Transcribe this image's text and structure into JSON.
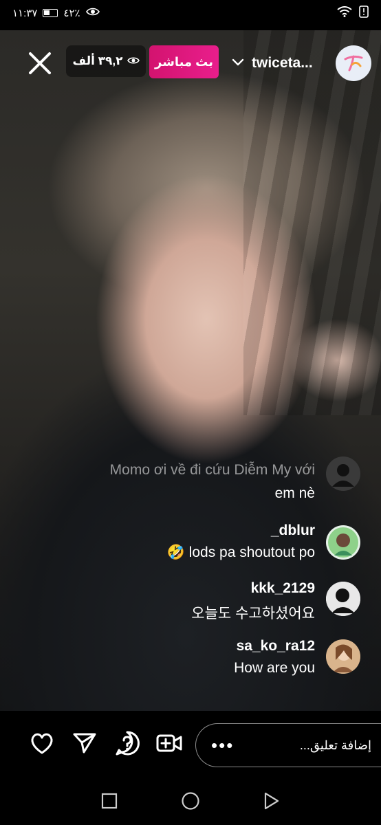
{
  "status_bar": {
    "time": "١١:٣٧",
    "battery": "٤٢٪",
    "icons": [
      "battery-icon",
      "eye-comfort-icon",
      "wifi-icon",
      "alert-icon"
    ]
  },
  "header": {
    "viewer_count": "٣٩,٢ ألف",
    "live_label": "بث مباشر",
    "username": "twiceta...",
    "colors": {
      "live": "#e91e8c"
    }
  },
  "comments": [
    {
      "user": "",
      "text_lines": [
        "Momo ơi về đi cứu Diễm My với",
        "em nè"
      ],
      "avatar": "default-avatar-icon"
    },
    {
      "user": "_dblur",
      "text": "🤣 lods pa shoutout po",
      "avatar": "user-avatar"
    },
    {
      "user": "kkk_2129",
      "text": "오늘도 수고하셨어요",
      "avatar": "user-avatar"
    },
    {
      "user": "sa_ko_ra12",
      "text": "How are you",
      "avatar": "user-avatar"
    }
  ],
  "action_bar": {
    "comment_placeholder": "إضافة تعليق...",
    "icons": [
      "heart-icon",
      "send-icon",
      "question-icon",
      "add-video-icon",
      "more-icon"
    ]
  },
  "nav_bar": {
    "icons": [
      "recents-icon",
      "home-icon",
      "back-icon"
    ]
  }
}
